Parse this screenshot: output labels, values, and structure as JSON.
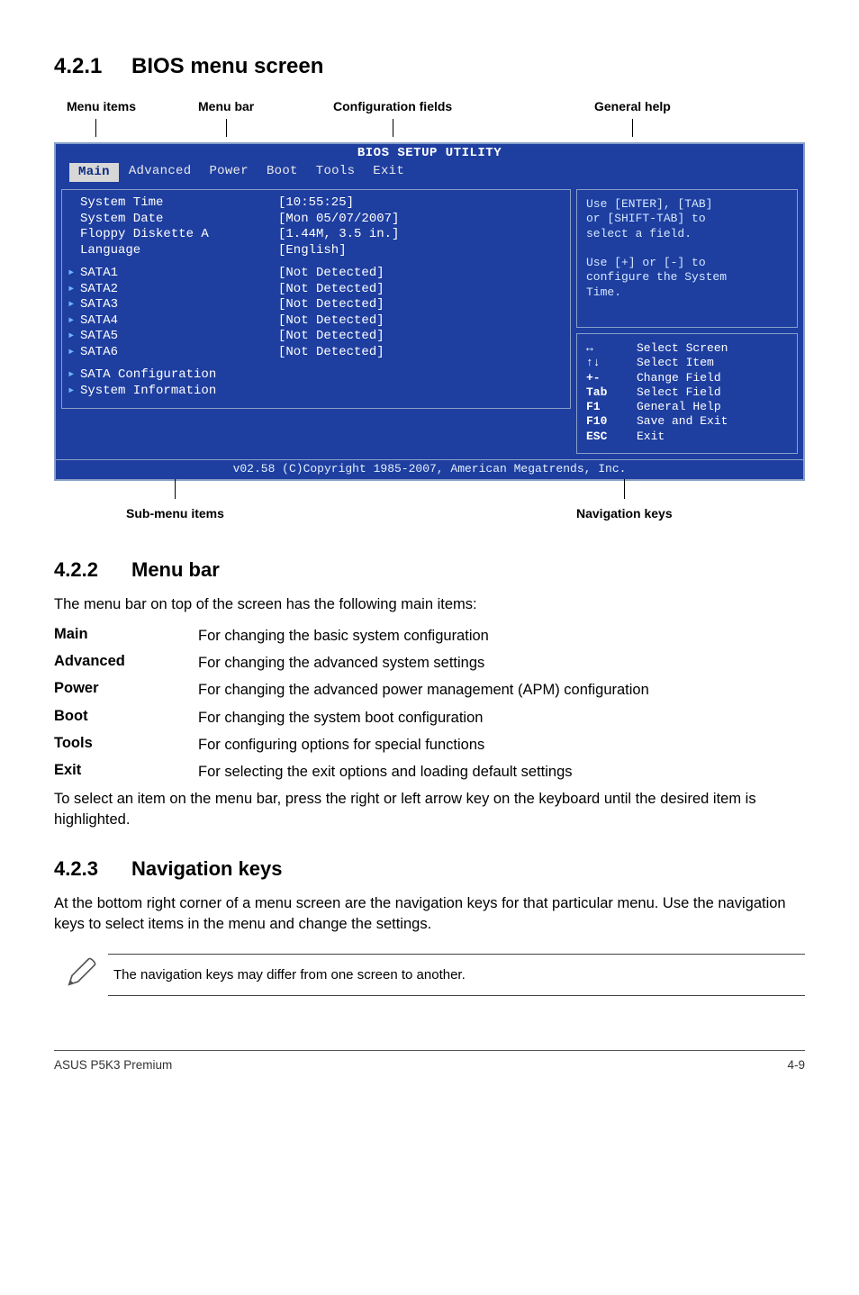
{
  "sections": {
    "s1": {
      "num": "4.2.1",
      "title": "BIOS menu screen"
    },
    "s2": {
      "num": "4.2.2",
      "title": "Menu bar"
    },
    "s3": {
      "num": "4.2.3",
      "title": "Navigation keys"
    }
  },
  "annot": {
    "menu_items": "Menu items",
    "menu_bar": "Menu bar",
    "config_fields": "Configuration fields",
    "general_help": "General help",
    "sub_menu": "Sub-menu items",
    "nav_keys": "Navigation keys"
  },
  "bios": {
    "title": "BIOS SETUP UTILITY",
    "tabs": [
      "Main",
      "Advanced",
      "Power",
      "Boot",
      "Tools",
      "Exit"
    ],
    "tab_selected": 0,
    "left": {
      "plain": [
        {
          "label": "System Time",
          "value": "[10:55:25]"
        },
        {
          "label": "System Date",
          "value": "[Mon 05/07/2007]"
        },
        {
          "label": "Floppy Diskette A",
          "value": "[1.44M, 3.5 in.]"
        },
        {
          "label": "Language",
          "value": "[English]"
        }
      ],
      "sata": [
        {
          "label": "SATA1",
          "value": "[Not Detected]"
        },
        {
          "label": "SATA2",
          "value": "[Not Detected]"
        },
        {
          "label": "SATA3",
          "value": "[Not Detected]"
        },
        {
          "label": "SATA4",
          "value": "[Not Detected]"
        },
        {
          "label": "SATA5",
          "value": "[Not Detected]"
        },
        {
          "label": "SATA6",
          "value": "[Not Detected]"
        }
      ],
      "more": [
        "SATA Configuration",
        "System Information"
      ]
    },
    "help": "Use [ENTER], [TAB]\nor [SHIFT-TAB] to\nselect a field.\n\nUse [+] or [-] to\nconfigure the System\nTime.",
    "nav": [
      {
        "icon": "↔",
        "label": "Select Screen"
      },
      {
        "icon": "↑↓",
        "label": "Select Item"
      },
      {
        "icon": "+-",
        "label": "Change Field"
      },
      {
        "icon": "Tab",
        "label": "Select Field"
      },
      {
        "icon": "F1",
        "label": "General Help"
      },
      {
        "icon": "F10",
        "label": "Save and Exit"
      },
      {
        "icon": "ESC",
        "label": "Exit"
      }
    ],
    "footer": "v02.58 (C)Copyright 1985-2007, American Megatrends, Inc."
  },
  "menubar": {
    "intro": "The menu bar on top of the screen has the following main items:",
    "rows": [
      {
        "k": "Main",
        "v": "For changing the basic system configuration"
      },
      {
        "k": "Advanced",
        "v": "For changing the advanced system settings"
      },
      {
        "k": "Power",
        "v": "For changing the advanced power management (APM) configuration"
      },
      {
        "k": "Boot",
        "v": "For changing the system boot configuration"
      },
      {
        "k": "Tools",
        "v": "For configuring options for special functions"
      },
      {
        "k": "Exit",
        "v": "For selecting the exit options and loading default settings"
      }
    ],
    "outro": "To select an item on the menu bar, press the right or left arrow key on the keyboard until the desired item is highlighted."
  },
  "navkeys": {
    "intro": "At the bottom right corner of a menu screen are the navigation keys for that particular menu. Use the navigation keys to select items in the menu and change the settings."
  },
  "note": "The navigation keys may differ from one screen to another.",
  "footer": {
    "left": "ASUS P5K3 Premium",
    "right": "4-9"
  }
}
